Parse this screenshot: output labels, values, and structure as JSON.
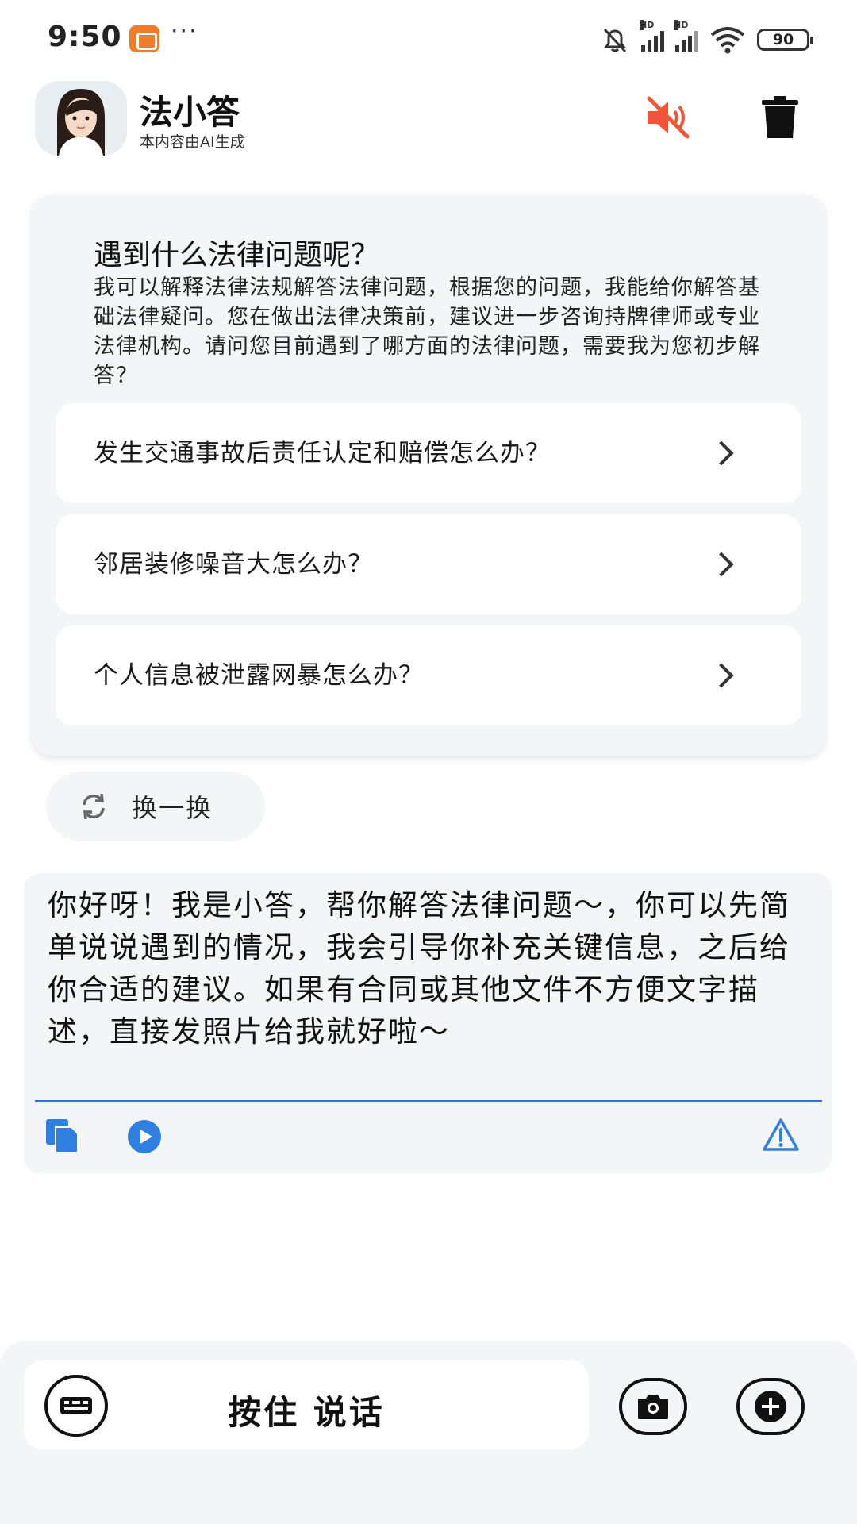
{
  "status_bar": {
    "time": "9:50",
    "more": "···",
    "battery": "90",
    "signal_1_label": "HD",
    "signal_2_label": "HD"
  },
  "header": {
    "name": "法小答",
    "subtitle": "本内容由AI生成"
  },
  "card": {
    "title": "遇到什么法律问题呢？",
    "description": "我可以解释法律法规解答法律问题，根据您的问题，我能给你解答基础法律疑问。您在做出法律决策前，建议进一步咨询持牌律师或专业法律机构。请问您目前遇到了哪方面的法律问题，需要我为您初步解答？",
    "suggestions": [
      "发生交通事故后责任认定和赔偿怎么办？",
      "邻居装修噪音大怎么办？",
      "个人信息被泄露网暴怎么办？"
    ]
  },
  "refresh_label": "换一换",
  "reply": {
    "text": "你好呀！我是小答，帮你解答法律问题～，你可以先简单说说遇到的情况，我会引导你补充关键信息，之后给你合适的建议。如果有合同或其他文件不方便文字描述，直接发照片给我就好啦～"
  },
  "input_bar": {
    "voice_label": "按住 说话"
  },
  "colors": {
    "accent_blue": "#2f7fe0",
    "mute_red": "#f0553a",
    "card_bg": "#f4f5f7"
  }
}
